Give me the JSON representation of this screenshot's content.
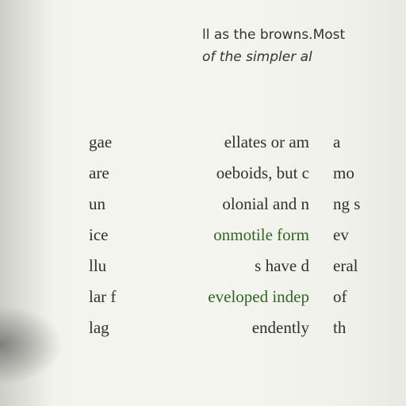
{
  "top_text": {
    "line1": "ll as the browns.Most",
    "line2": "of the simpler al"
  },
  "columns": {
    "col1": [
      "gae",
      "are",
      "un",
      "ice",
      "llu",
      "lar f",
      "lag"
    ],
    "col2": [
      "ellates or am",
      "oeboids, but c",
      "olonial and n",
      "onmotile form",
      "s have d",
      "eveloped indep",
      "endently"
    ],
    "col3": [
      "a",
      "mo",
      "ng s",
      "ev",
      "eral",
      "of",
      "th"
    ]
  },
  "colors": {
    "text": "#303030",
    "highlight_green": "#2b6a1e",
    "paper": "#f3f3ee"
  }
}
